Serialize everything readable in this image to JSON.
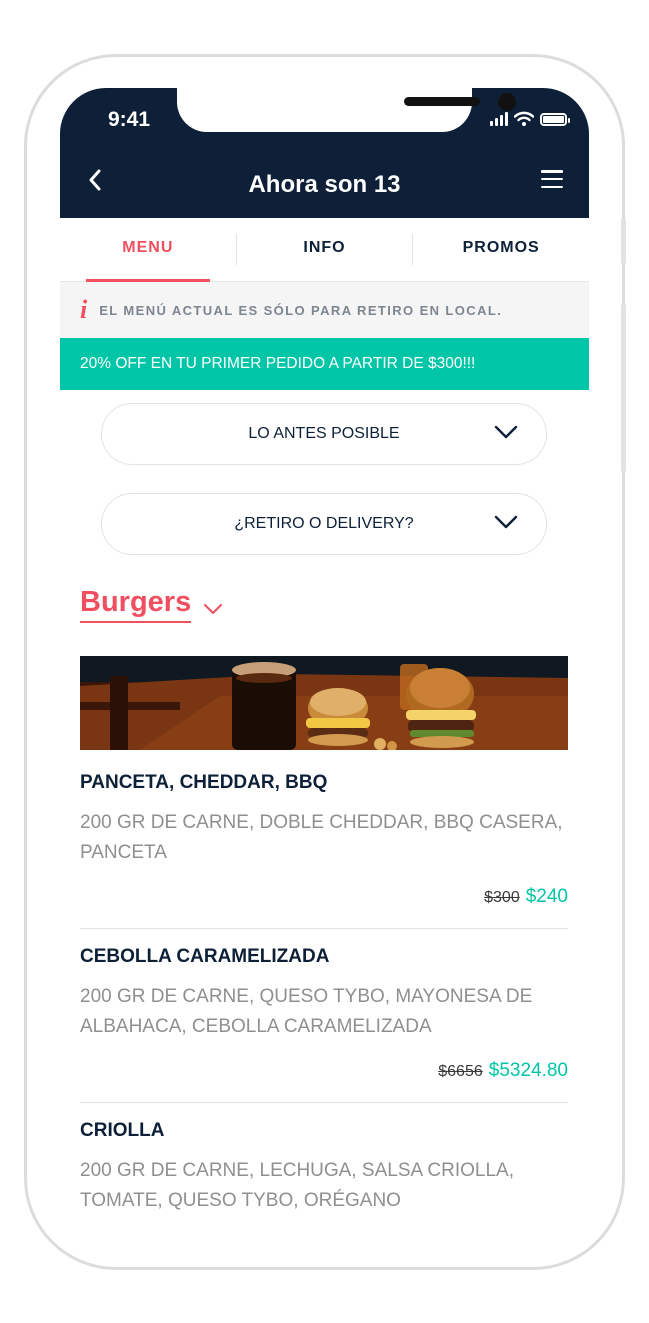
{
  "status": {
    "time": "9:41"
  },
  "header": {
    "title": "Ahora son 13"
  },
  "tabs": [
    {
      "label": "MENU"
    },
    {
      "label": "INFO"
    },
    {
      "label": "PROMOS"
    }
  ],
  "notice": {
    "text": "EL MENÚ ACTUAL ES SÓLO PARA RETIRO EN LOCAL."
  },
  "promo": {
    "text": "20% OFF EN TU PRIMER PEDIDO A PARTIR DE $300!!!"
  },
  "selectors": {
    "time": "LO ANTES POSIBLE",
    "mode": "¿RETIRO O DELIVERY?"
  },
  "section": {
    "title": "Burgers"
  },
  "items": [
    {
      "name": "PANCETA, CHEDDAR, BBQ",
      "desc": "200 GR DE CARNE, DOBLE CHEDDAR, BBQ CASERA, PANCETA",
      "old_price": "$300",
      "price": "$240"
    },
    {
      "name": "CEBOLLA CARAMELIZADA",
      "desc": "200 GR DE CARNE, QUESO TYBO, MAYONESA DE ALBAHACA, CEBOLLA CARAMELIZADA",
      "old_price": "$6656",
      "price": "$5324.80"
    },
    {
      "name": "CRIOLLA",
      "desc": "200 GR DE CARNE, LECHUGA, SALSA CRIOLLA, TOMATE, QUESO TYBO, ORÉGANO"
    }
  ],
  "colors": {
    "navy": "#0d2038",
    "accent": "#ef4f5f",
    "teal": "#00c5a6"
  }
}
